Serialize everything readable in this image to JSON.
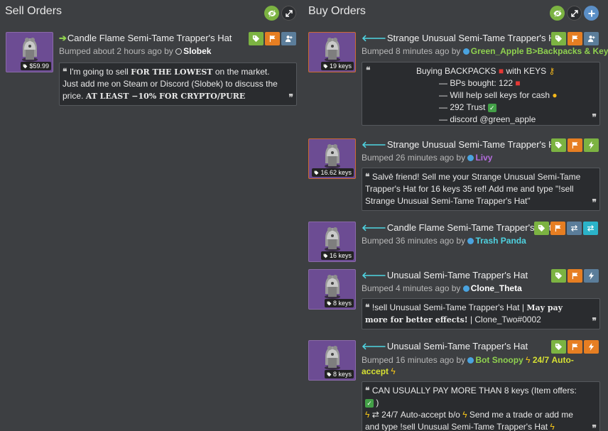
{
  "sell": {
    "title": "Sell Orders",
    "listings": [
      {
        "price": "$59.99",
        "arrow": "➔",
        "name": "Candle Flame Semi-Tame Trapper's Hat",
        "bumped": "Bumped about 2 hours ago by",
        "user": "Slobek",
        "desc_parts": [
          "I'm going to sell ",
          "FOR THE LOWEST",
          " on the market. Just add me on Steam or Discord (Slobek) to discuss the price. ",
          "AT LEAST −10% FOR CRYPTO/PURE"
        ]
      }
    ]
  },
  "buy": {
    "title": "Buy Orders",
    "listings": [
      {
        "price": "19 keys",
        "arrow": "🡐",
        "name": "Strange Unusual Semi-Tame Trapper's Hat",
        "bumped": "Bumped 8 minutes ago by",
        "user": "Green_Apple B>Backpacks & Keys",
        "desc_lines": [
          "Buying BACKPACKS",
          "with KEYS",
          "— BPs bought: 122",
          "— Will help sell keys for cash",
          "— 292 Trust",
          "— discord @green_apple"
        ]
      },
      {
        "price": "16.62 keys",
        "arrow": "🡐",
        "name": "Strange Unusual Semi-Tame Trapper's Hat",
        "bumped": "Bumped 26 minutes ago by",
        "user": "Livy",
        "desc": "Salvē friend! Sell me your Strange Unusual Semi-Tame Trapper's Hat for 16 keys 35 ref! Add me and type \"!sell Strange Unusual Semi-Tame Trapper's Hat\""
      },
      {
        "price": "16 keys",
        "arrow": "🡐",
        "name": "Candle Flame Semi-Tame Trapper's Hat",
        "bumped": "Bumped 36 minutes ago by",
        "user": "Trash Panda"
      },
      {
        "price": "8 keys",
        "arrow": "🡐",
        "name": "Unusual Semi-Tame Trapper's Hat",
        "bumped": "Bumped 4 minutes ago by",
        "user": "Clone_Theta",
        "desc_parts": [
          "!sell Unusual Semi-Tame Trapper's Hat | ",
          "May pay more for better effects!",
          " | Clone_Two#0002"
        ]
      },
      {
        "price": "8 keys",
        "arrow": "🡐",
        "name": "Unusual Semi-Tame Trapper's Hat",
        "bumped": "Bumped 16 minutes ago by",
        "user": "Bot Snoopy",
        "user_suffix": "24/7 Auto-accept",
        "desc_parts": [
          "CAN USUALLY PAY MORE THAN 8 keys (Item offers:",
          ")",
          "⇄ 24/7 Auto-accept b/o",
          "Send me a trade or add me and type !sell Unusual Semi-Tame Trapper's Hat"
        ]
      }
    ]
  },
  "colors": {
    "background": "#3d3f42",
    "accent_green": "#7cb342",
    "accent_orange": "#e67e22",
    "accent_slate": "#5b7d9a",
    "accent_cyan": "#2bb3c9",
    "user_green": "#8fd14f",
    "user_purple": "#b36bdc",
    "user_cyan": "#4fd2e0",
    "user_white": "#ffffff",
    "user_yellow": "#d6e033"
  },
  "icons": [
    "eye-icon",
    "expand-icon",
    "plus-icon",
    "tag-icon",
    "flag-icon",
    "user-add-icon",
    "bolt-icon",
    "exchange-icon"
  ]
}
